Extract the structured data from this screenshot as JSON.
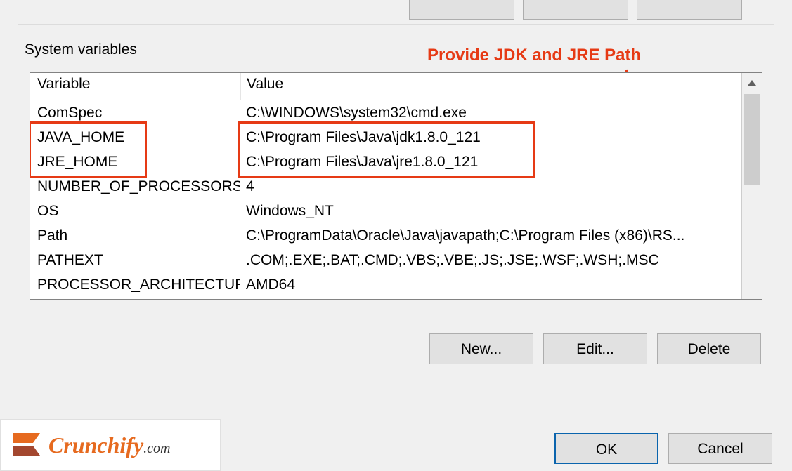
{
  "section_title": "System variables",
  "annotation": "Provide JDK and JRE Path",
  "headers": {
    "variable": "Variable",
    "value": "Value"
  },
  "rows": [
    {
      "variable": "ComSpec",
      "value": "C:\\WINDOWS\\system32\\cmd.exe"
    },
    {
      "variable": "JAVA_HOME",
      "value": "C:\\Program Files\\Java\\jdk1.8.0_121"
    },
    {
      "variable": "JRE_HOME",
      "value": "C:\\Program Files\\Java\\jre1.8.0_121"
    },
    {
      "variable": "NUMBER_OF_PROCESSORS",
      "value": "4"
    },
    {
      "variable": "OS",
      "value": "Windows_NT"
    },
    {
      "variable": "Path",
      "value": "C:\\ProgramData\\Oracle\\Java\\javapath;C:\\Program Files (x86)\\RS..."
    },
    {
      "variable": "PATHEXT",
      "value": ".COM;.EXE;.BAT;.CMD;.VBS;.VBE;.JS;.JSE;.WSF;.WSH;.MSC"
    },
    {
      "variable": "PROCESSOR_ARCHITECTURE",
      "value": "AMD64"
    }
  ],
  "buttons": {
    "new": "New...",
    "edit": "Edit...",
    "delete": "Delete",
    "ok": "OK",
    "cancel": "Cancel"
  },
  "logo": {
    "brand": "Crunchify",
    "suffix": ".com"
  }
}
